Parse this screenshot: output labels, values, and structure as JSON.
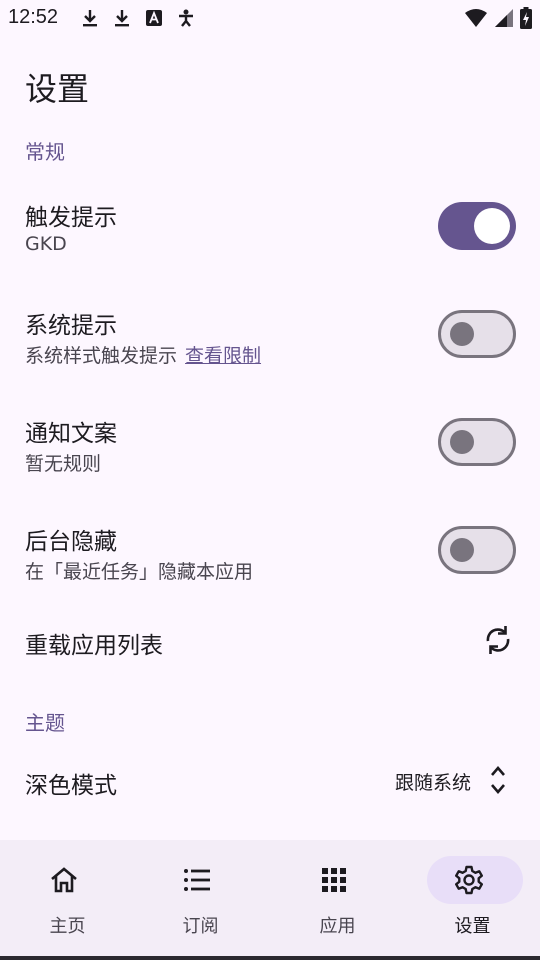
{
  "status_bar": {
    "time": "12:52",
    "left_icons": [
      "download-icon",
      "download-icon",
      "font-a-icon",
      "accessibility-icon"
    ],
    "right_icons": [
      "wifi-icon",
      "cell-signal-icon",
      "battery-charging-icon"
    ]
  },
  "page": {
    "title": "设置"
  },
  "sections": {
    "general": {
      "header": "常规",
      "trigger_hint": {
        "title": "触发提示",
        "subtitle": "GKD",
        "enabled": true
      },
      "system_hint": {
        "title": "系统提示",
        "subtitle": "系统样式触发提示",
        "link": "查看限制",
        "enabled": false
      },
      "notification_text": {
        "title": "通知文案",
        "subtitle": "暂无规则",
        "enabled": false
      },
      "background_hide": {
        "title": "后台隐藏",
        "subtitle": "在「最近任务」隐藏本应用",
        "enabled": false
      },
      "reload_apps": {
        "title": "重载应用列表",
        "icon": "refresh-icon"
      }
    },
    "theme": {
      "header": "主题",
      "dark_mode": {
        "title": "深色模式",
        "value": "跟随系统"
      }
    }
  },
  "bottom_nav": {
    "items": [
      {
        "label": "主页",
        "icon": "home-icon"
      },
      {
        "label": "订阅",
        "icon": "list-icon"
      },
      {
        "label": "应用",
        "icon": "apps-grid-icon"
      },
      {
        "label": "设置",
        "icon": "gear-icon",
        "active": true
      }
    ]
  },
  "colors": {
    "accent": "#65558f",
    "background": "#fdf7ff",
    "nav_background": "#f3edf7",
    "active_pill": "#e8def8"
  }
}
